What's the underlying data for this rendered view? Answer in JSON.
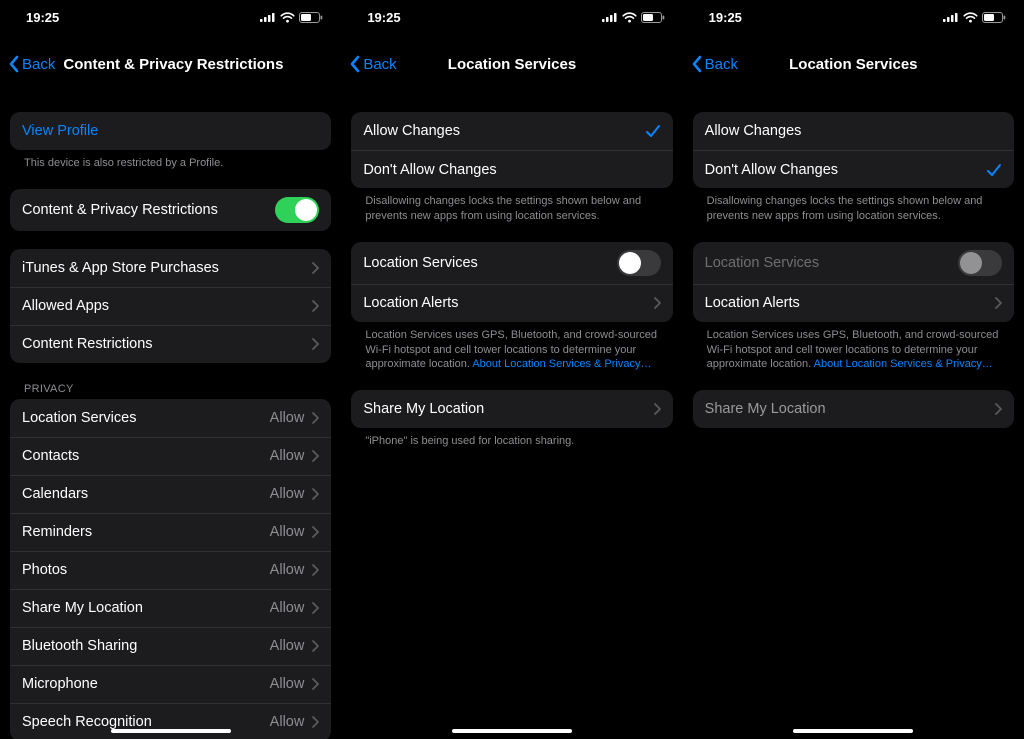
{
  "status": {
    "time": "19:25"
  },
  "common": {
    "back": "Back"
  },
  "phone1": {
    "title": "Content & Privacy Restrictions",
    "view_profile": "View Profile",
    "profile_footer": "This device is also restricted by a Profile.",
    "cpr_label": "Content & Privacy Restrictions",
    "rows": {
      "itunes": "iTunes & App Store Purchases",
      "allowed_apps": "Allowed Apps",
      "content_restrictions": "Content Restrictions"
    },
    "privacy_header": "Privacy",
    "allow": "Allow",
    "privacy_rows": [
      "Location Services",
      "Contacts",
      "Calendars",
      "Reminders",
      "Photos",
      "Share My Location",
      "Bluetooth Sharing",
      "Microphone",
      "Speech Recognition"
    ]
  },
  "phone2": {
    "title": "Location Services",
    "allow_changes": "Allow Changes",
    "dont_allow_changes": "Don't Allow Changes",
    "changes_footer": "Disallowing changes locks the settings shown below and prevents new apps from using location services.",
    "ls_label": "Location Services",
    "alerts_label": "Location Alerts",
    "ls_footer_text": "Location Services uses GPS, Bluetooth, and crowd-sourced Wi-Fi hotspot and cell tower locations to determine your approximate location. ",
    "ls_footer_link": "About Location Services & Privacy…",
    "share_label": "Share My Location",
    "share_footer": "\"iPhone\" is being used for location sharing."
  },
  "phone3": {
    "title": "Location Services",
    "allow_changes": "Allow Changes",
    "dont_allow_changes": "Don't Allow Changes",
    "changes_footer": "Disallowing changes locks the settings shown below and prevents new apps from using location services.",
    "ls_label": "Location Services",
    "alerts_label": "Location Alerts",
    "ls_footer_text": "Location Services uses GPS, Bluetooth, and crowd-sourced Wi-Fi hotspot and cell tower locations to determine your approximate location. ",
    "ls_footer_link": "About Location Services & Privacy…",
    "share_label": "Share My Location"
  }
}
